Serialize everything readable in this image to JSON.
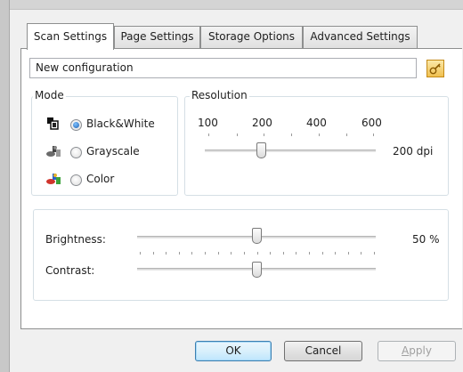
{
  "tabs": [
    {
      "label": "Scan Settings",
      "active": true
    },
    {
      "label": "Page Settings",
      "active": false
    },
    {
      "label": "Storage Options",
      "active": false
    },
    {
      "label": "Advanced Settings",
      "active": false
    }
  ],
  "config_name": "New configuration",
  "mode": {
    "title": "Mode",
    "options": [
      {
        "label": "Black&White",
        "checked": true
      },
      {
        "label": "Grayscale",
        "checked": false
      },
      {
        "label": "Color",
        "checked": false
      }
    ]
  },
  "resolution": {
    "title": "Resolution",
    "tick_labels": [
      "100",
      "200",
      "400",
      "600"
    ],
    "value_label": "200 dpi",
    "level": 0.33
  },
  "adjust": {
    "brightness_label": "Brightness:",
    "brightness_value": "50 %",
    "brightness_level": 0.5,
    "contrast_label": "Contrast:",
    "contrast_level": 0.5
  },
  "buttons": {
    "ok": "OK",
    "cancel": "Cancel",
    "apply_first": "A",
    "apply_rest": "pply"
  },
  "colors": {
    "selected_radio": "#1d5fb0",
    "default_button_border": "#3c7fb1",
    "edit_icon": "#f0c050"
  },
  "icons": {
    "edit": "edit-icon",
    "bw": "black-white-mode-icon",
    "gray": "grayscale-mode-icon",
    "color": "color-mode-icon"
  }
}
